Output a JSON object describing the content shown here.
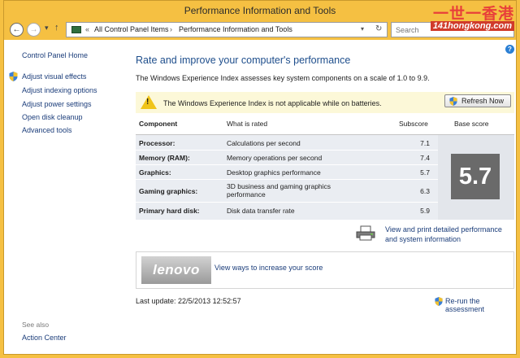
{
  "window": {
    "title": "Performance Information and Tools"
  },
  "watermark": {
    "top": "一世一香港",
    "url": "141hongkong.com"
  },
  "nav": {
    "back": "←",
    "forward": "→",
    "recent": "▾",
    "up": "↑"
  },
  "address": {
    "overflow": "«",
    "crumbs": [
      "All Control Panel Items",
      "Performance Information and Tools"
    ],
    "separator": "›",
    "dropdown": "▾",
    "refresh": "↻"
  },
  "search": {
    "placeholder": "Search"
  },
  "help": "?",
  "sidebar": {
    "home": "Control Panel Home",
    "links": [
      "Adjust visual effects",
      "Adjust indexing options",
      "Adjust power settings",
      "Open disk cleanup",
      "Advanced tools"
    ],
    "see_also_label": "See also",
    "see_also_links": [
      "Action Center"
    ]
  },
  "main": {
    "heading": "Rate and improve your computer's performance",
    "intro": "The Windows Experience Index assesses key system components on a scale of 1.0 to 9.9.",
    "warning": "The Windows Experience Index is not applicable while on batteries.",
    "refresh_button": "Refresh Now",
    "table": {
      "headers": {
        "component": "Component",
        "rated": "What is rated",
        "subscore": "Subscore",
        "base": "Base score"
      },
      "rows": [
        {
          "component": "Processor:",
          "rated": "Calculations per second",
          "subscore": "7.1"
        },
        {
          "component": "Memory (RAM):",
          "rated": "Memory operations per second",
          "subscore": "7.4"
        },
        {
          "component": "Graphics:",
          "rated": "Desktop graphics performance",
          "subscore": "5.7"
        },
        {
          "component": "Gaming graphics:",
          "rated": "3D business and gaming graphics performance",
          "subscore": "6.3"
        },
        {
          "component": "Primary hard disk:",
          "rated": "Disk data transfer rate",
          "subscore": "5.9"
        }
      ],
      "base_score": "5.7"
    },
    "print_link": "View and print detailed performance and system information",
    "promo_logo": "lenovo",
    "promo_link": "View ways to increase your score",
    "last_update": "Last update: 22/5/2013 12:52:57",
    "rerun_link": "Re-run the assessment"
  },
  "colors": {
    "frame": "#f5c042",
    "link": "#1b3d7a",
    "heading": "#1e4e8c",
    "warning_bg": "#fcf8d8",
    "base_box": "#6a6a6a"
  }
}
